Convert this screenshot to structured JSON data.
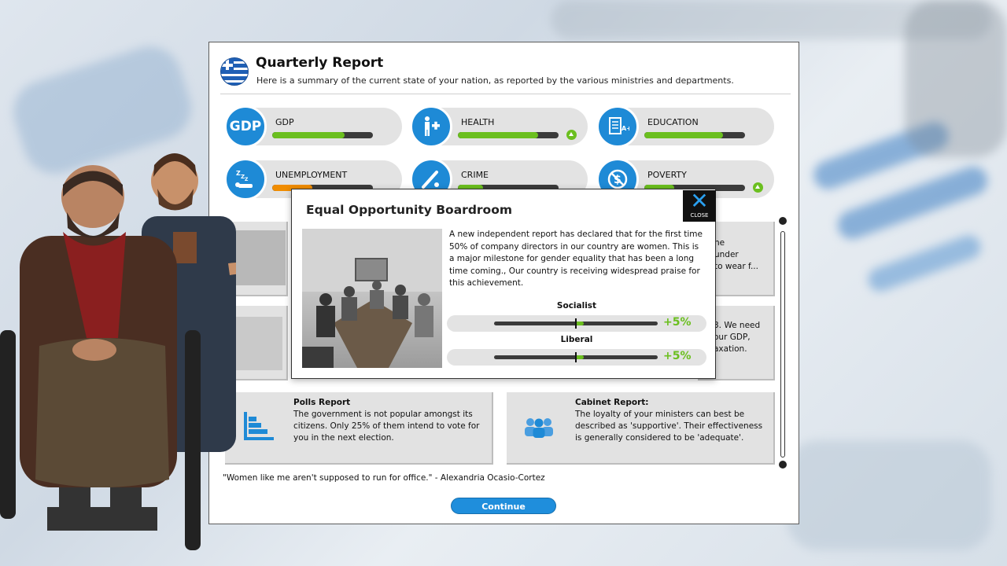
{
  "header": {
    "title": "Quarterly Report",
    "subtitle": "Here is a summary of the current state of your nation, as reported by the various ministries and departments."
  },
  "stats": [
    {
      "label": "GDP",
      "value": 0.72,
      "color": "#6bbf1f",
      "icon": "gdp-icon",
      "trend": null
    },
    {
      "label": "HEALTH",
      "value": 0.8,
      "color": "#6bbf1f",
      "icon": "health-icon",
      "trend": "up"
    },
    {
      "label": "EDUCATION",
      "value": 0.78,
      "color": "#6bbf1f",
      "icon": "education-icon",
      "trend": null
    },
    {
      "label": "UNEMPLOYMENT",
      "value": 0.4,
      "color": "#f08c00",
      "icon": "unemployment-icon",
      "trend": null
    },
    {
      "label": "CRIME",
      "value": 0.25,
      "color": "#6bbf1f",
      "icon": "crime-icon",
      "trend": null
    },
    {
      "label": "POVERTY",
      "value": 0.3,
      "color": "#6bbf1f",
      "icon": "poverty-icon",
      "trend": "up"
    }
  ],
  "cards": {
    "right1_text": "he\nunder\nto wear f...",
    "right2_text": "3. We need\nour GDP,\naxation.",
    "polls_title": "Polls Report",
    "polls_text": "The government is not popular amongst its citizens. Only 25% of them intend to vote for you in the next election.",
    "cabinet_title": "Cabinet Report:",
    "cabinet_text": "The loyalty of your ministers can best be described as 'supportive'. Their effectiveness is generally considered to be 'adequate'."
  },
  "quote": "\"Women like me aren't supposed to run for office.\" - Alexandria Ocasio-Cortez",
  "continue_label": "Continue",
  "popup": {
    "title": "Equal Opportunity Boardroom",
    "close_label": "CLOSE",
    "text": "A new independent report has declared that for the first time 50% of company directors in our country are women. This is a major milestone for gender equality that has been a long time coming., Our country is receiving widespread praise for this achievement.",
    "effects": [
      {
        "group": "Socialist",
        "change": "+5%",
        "value": 5
      },
      {
        "group": "Liberal",
        "change": "+5%",
        "value": 5
      }
    ]
  },
  "colors": {
    "accent": "#1e8ad6",
    "positive": "#6bbf1f",
    "warning": "#f08c00"
  }
}
